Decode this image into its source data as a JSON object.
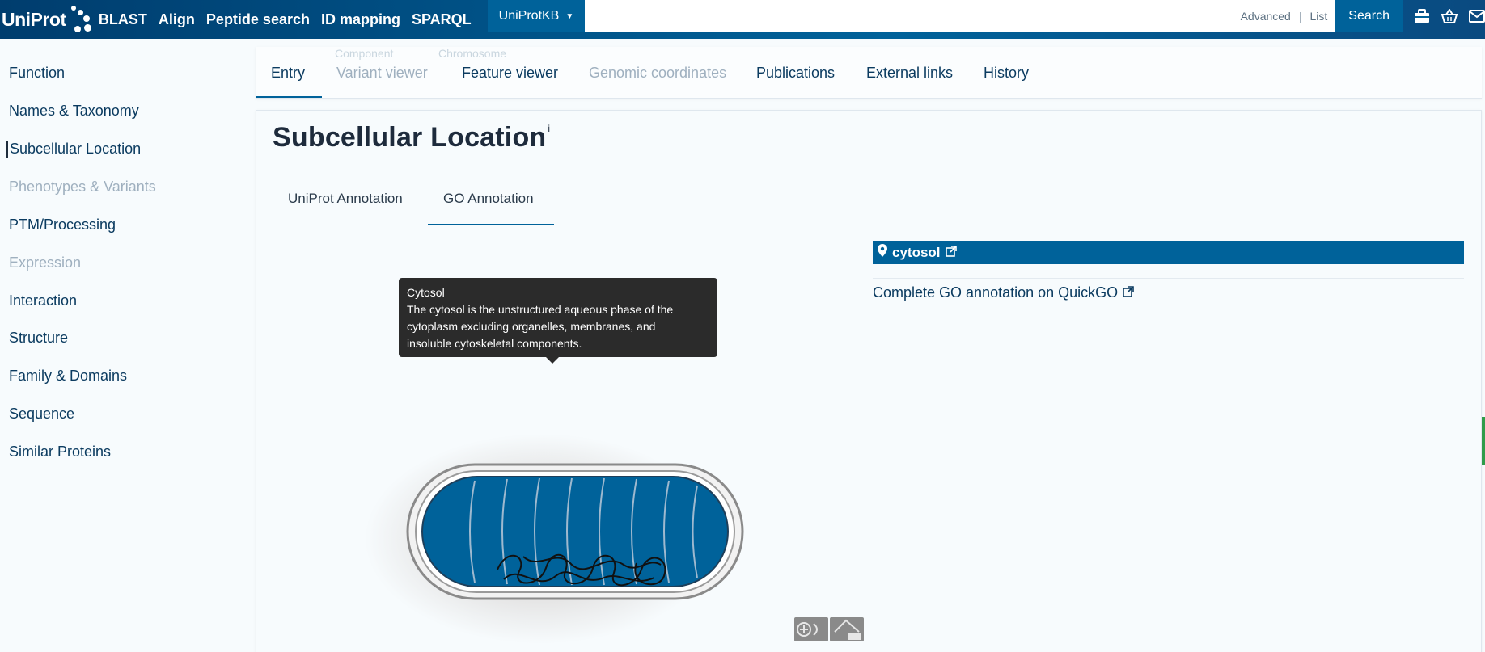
{
  "header": {
    "logo_text": "UniProt",
    "nav": [
      "BLAST",
      "Align",
      "Peptide search",
      "ID mapping",
      "SPARQL"
    ],
    "database_selector": "UniProtKB",
    "search_links": {
      "advanced": "Advanced",
      "separator": "|",
      "list": "List"
    },
    "search_button": "Search",
    "icons": [
      "tools-icon",
      "basket-icon",
      "mail-icon"
    ]
  },
  "sidebar": {
    "items": [
      {
        "label": "Function",
        "state": "normal"
      },
      {
        "label": "Names & Taxonomy",
        "state": "normal"
      },
      {
        "label": "Subcellular Location",
        "state": "active"
      },
      {
        "label": "Phenotypes & Variants",
        "state": "disabled"
      },
      {
        "label": "PTM/Processing",
        "state": "normal"
      },
      {
        "label": "Expression",
        "state": "disabled"
      },
      {
        "label": "Interaction",
        "state": "normal"
      },
      {
        "label": "Structure",
        "state": "normal"
      },
      {
        "label": "Family & Domains",
        "state": "normal"
      },
      {
        "label": "Sequence",
        "state": "normal"
      },
      {
        "label": "Similar Proteins",
        "state": "normal"
      }
    ]
  },
  "tabs": {
    "items": [
      {
        "label": "Entry",
        "state": "active"
      },
      {
        "label": "Variant viewer",
        "state": "disabled"
      },
      {
        "label": "Feature viewer",
        "state": "normal"
      },
      {
        "label": "Genomic coordinates",
        "state": "disabled"
      },
      {
        "label": "Publications",
        "state": "normal"
      },
      {
        "label": "External links",
        "state": "normal"
      },
      {
        "label": "History",
        "state": "normal"
      }
    ],
    "ghost": [
      "Component",
      "Chromosome"
    ]
  },
  "section": {
    "title": "Subcellular Location",
    "info_marker": "i",
    "subtabs": [
      "UniProt Annotation",
      "GO Annotation"
    ],
    "active_subtab": "GO Annotation",
    "location_label": "cytosol",
    "quickgo_link": "Complete GO annotation on QuickGO"
  },
  "tooltip": {
    "title": "Cytosol",
    "line1": "The cytosol is the unstructured aqueous phase of the",
    "line2": "cytoplasm excluding organelles, membranes, and",
    "line3": "insoluble cytoskeletal components."
  },
  "colors": {
    "brand": "#00629a",
    "header_dark": "#003d6e",
    "cell_fill": "#00629a",
    "tooltip_bg": "#2b2b2b"
  }
}
